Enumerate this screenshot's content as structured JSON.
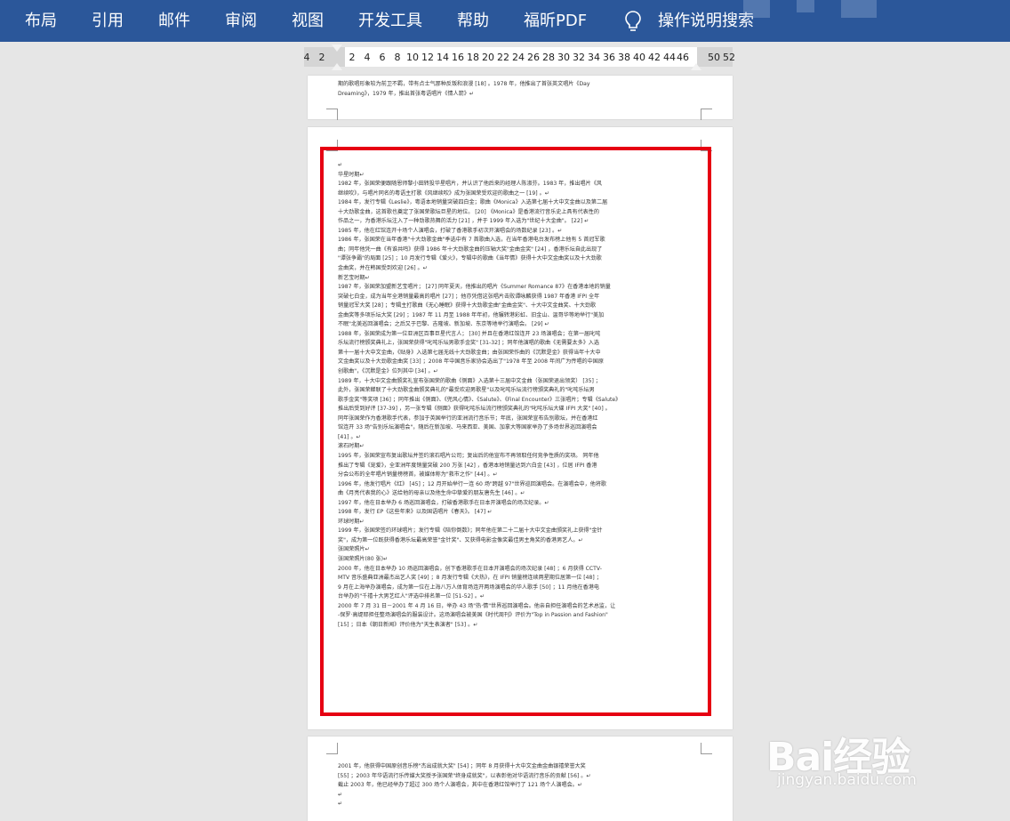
{
  "ribbon": {
    "tabs": [
      "布局",
      "引用",
      "邮件",
      "审阅",
      "视图",
      "开发工具",
      "帮助",
      "福昕PDF"
    ],
    "search_label": "操作说明搜索",
    "color": "#2b579a"
  },
  "ruler": {
    "ticks": [
      "4",
      "2",
      "2",
      "4",
      "6",
      "8",
      "10",
      "12",
      "14",
      "16",
      "18",
      "20",
      "22",
      "24",
      "26",
      "28",
      "30",
      "32",
      "34",
      "36",
      "38",
      "40",
      "42",
      "44",
      "46",
      "50",
      "52"
    ]
  },
  "page1": {
    "lines": [
      "期的歌唱形象较为前卫不羁，带有点士气那种反叛和浪漫 [18] 。1978 年，他推出了首张英文唱片《Day",
      "Dreaming》，1979 年，推出首张粤语唱片《情人箭》↵"
    ]
  },
  "page2": {
    "lines": [
      "↵",
      "华星时期↵",
      "1982 年，张国荣便跟随恩师黎小田转投华星唱片，并认识了他后来的经理人陈淑芬。1983 年，推出唱片《风",
      "继续吹》，与唱片同名的粤语主打歌《风继续吹》成为张国荣受欢迎的歌曲之一 [19] 。↵",
      "1984 年，发行专辑《Leslie》，粤语本地销量突破四白金；歌曲《Monica》入选第七届十大中文金曲以及第二届",
      "十大劲歌金曲，这首歌也奠定了张国荣歌坛巨星的地位。 [20] 《Monica》是香港流行音乐史上具有代表性的",
      "作品之一，为香港乐坛注入了一种劲歌热舞的活力 [21] ，并于 1999 年入选为\"世纪十大金曲\"。 [22] ↵",
      "1985 年，他在红馆连开十场个人演唱会，打破了香港歌手初次开演唱会的场数纪录 [23] 。↵",
      "1986 年，张国荣在当年香港\"十大劲歌金曲\"季选中有 7 首歌曲入选，在当年香港电台发布榜上他有 5 首冠军歌",
      "曲；同年他凭一曲《有谁共鸣》获得 1986 年十大劲歌金曲的压轴大奖\"金曲金奖\" [24] ，香港乐坛自此出现了",
      "\"谭张争霸\"的局面 [25] ；10 月发行专辑《爱火》，专辑中的歌曲《当年情》获得十大中文金曲奖以及十大劲歌",
      "金曲奖，并在韩国受到欢迎 [26] 。↵",
      "新艺宝时期↵",
      "1987 年，张国荣加盟新艺宝唱片； [27] 同年夏天，他推出的唱片《Summer Romance 87》在香港本地的销量",
      "突破七白金，成为当年全港销量最高的唱片 [27] ；他亦凭借这张唱片击败谭咏麟获得 1987 年香港 IFPI 全年",
      "销量冠军大奖 [28] ；专辑主打歌曲《无心睡眠》获得十大劲歌金曲\"金曲金奖\"、十大中文金曲奖、十大劲歌",
      "金曲奖等多项乐坛大奖 [29] ；1987 年 11 月至 1988 年年初，他辗转港彩虹、旧金山、温哥华等地举行\"美加",
      "不眠\"北美巡回演唱会；之后又于巴黎、吉隆坡、新加坡、东京等地举行演唱会。 [29] ↵",
      "1988 年，张国荣成为第一位亚洲区百事巨星代言人； [30] 并且在香港红馆连开 23 场演唱会；在第一届叱咤",
      "乐坛流行榜颁奖典礼上，张国荣获得\"叱咤乐坛男歌手金奖\" [31-32] ；同年他演唱的歌曲《无需要太多》入选",
      "第十一届十大中文金曲，《贴身》入选第七届无线十大劲歌金曲；由张国荣作曲的《沉默是金》获得当年十大中",
      "文金曲奖以及十大劲歌金曲奖 [33] ；2008 年中国音乐家协会选出了\"1978 年至 2008 年间广为传唱的中国原",
      "创歌曲\"，《沉默是金》位列其中 [34] 。↵",
      "1989 年，十大中文金曲颁奖礼宣布张国荣的歌曲《侧面》入选第十三届中文金曲（张国荣退出领奖） [35] ；",
      "此外，张国荣蝉联了十大劲歌金曲颁奖典礼的\"最受欢迎男歌星\"以及叱咤乐坛流行榜颁奖典礼的\"叱咤乐坛男",
      "歌手金奖\"等奖项 [36] ；同年推出《侧面》、《兜风心情》、《Salute》、《Final Encounter》三张唱片；专辑《Salute》",
      "推出后受到好评 [37-39] ，另一张专辑《侧面》获得叱咤乐坛流行榜颁奖典礼的\"叱咤乐坛大碟 IFPI 大奖\" [40] 。",
      "同年张国荣作为香港歌手代表，参加于英国举行的亚洲流行音乐节；年底，张国荣宣布告别歌坛，并在香港红",
      "馆连开 33 场\"告别乐坛演唱会\"，随后在新加坡、马来西亚、美国、加拿大等国家举办了多场世界巡回演唱会",
      "[41] 。↵",
      "滚石时期↵",
      "1995 年，张国荣宣布复出歌坛并签约滚石唱片公司；复出后的他宣布不再领取任何竞争性质的奖项。 同年他",
      "推出了专辑《宠爱》，全亚洲年度销量突破 200 万张 [42] ，香港本地销量达到六白金 [43] ，位居 IFPI 香港",
      "分会公布的全年唱片销量榜榜首，被媒体称为\"救市之作\" [44] 。↵",
      "1996 年，他发行唱片《红》 [45] ；12 月开始举行一连 60 场\"跨越 97\"世界巡回演唱会。在演唱会中，他将歌",
      "曲《月亮代表我的心》送给他的母亲以及他生命中挚爱的朋友唐先生 [46] 。↵",
      "1997 年，他在日本举办 6 场巡回演唱会，打破香港歌手在日本开演唱会的场次纪录。↵",
      "1998 年，发行 EP《这些年来》以及国语唱片《春天》。 [47] ↵",
      "环球时期↵",
      "1999 年，张国荣签约环球唱片；发行专辑《陪你倒数》；同年他在第二十二届十大中文金曲颁奖礼上获得\"金针",
      "奖\"，成为第一位既获得香港乐坛最高荣誉\"金针奖\"、又获得电影金像奖最佳男主角奖的香港男艺人。↵",
      "张国荣照片↵",
      "张国荣照片(80 张)↵",
      "2000 年，他在日本举办 10 场巡回演唱会，创下香港歌手在日本开演唱会的场次纪录 [48] ；6 月获得 CCTV-",
      "MTV 音乐盛典亚洲最杰出艺人奖 [49] ；8 月发行专辑《大热》，在 IFPI 销量榜连续两星期位居第一位 [48] ；",
      "9 月在上海举办演唱会，成为第一位在上海八万人体育场连开两场演唱会的华人歌手 [50] ；11 月他在香港电",
      "台举办的\"千禧十大男艺红人\"评选中排名第一位 [51-52] 。↵",
      "2000 年 7 月 31 日－2001 年 4 月 16 日，举办 43 场\"热·情\"世界巡回演唱会。他亲自担任演唱会的艺术总监，让",
      "-保罗·高缇耶担任整场演唱会的服装设计。这场演唱会被美国《时代周刊》评价为\"Top in Passion and Fashion\"",
      "[15] ；日本《朝日新闻》评价他为\"天生表演者\" [53] 。↵"
    ]
  },
  "page3": {
    "lines": [
      "2001 年，他获得中国原创音乐榜\"杰出成就大奖\" [54] ；同年 8 月获得十大中文金曲金曲银禧荣誉大奖",
      "[55] ；2003 年华语流行乐传媒大奖授予张国荣\"终身成就奖\"，以表彰他对华语流行音乐的贡献 [56] 。↵",
      "截止 2003 年，他已经举办了超过 300 场个人演唱会，其中在香港红馆举行了 121 场个人演唱会。↵",
      "↵",
      "↵"
    ]
  },
  "highlight_color": "#e60012",
  "watermark": {
    "logo": "Bai经验",
    "url": "jingyan.baidu.com"
  }
}
